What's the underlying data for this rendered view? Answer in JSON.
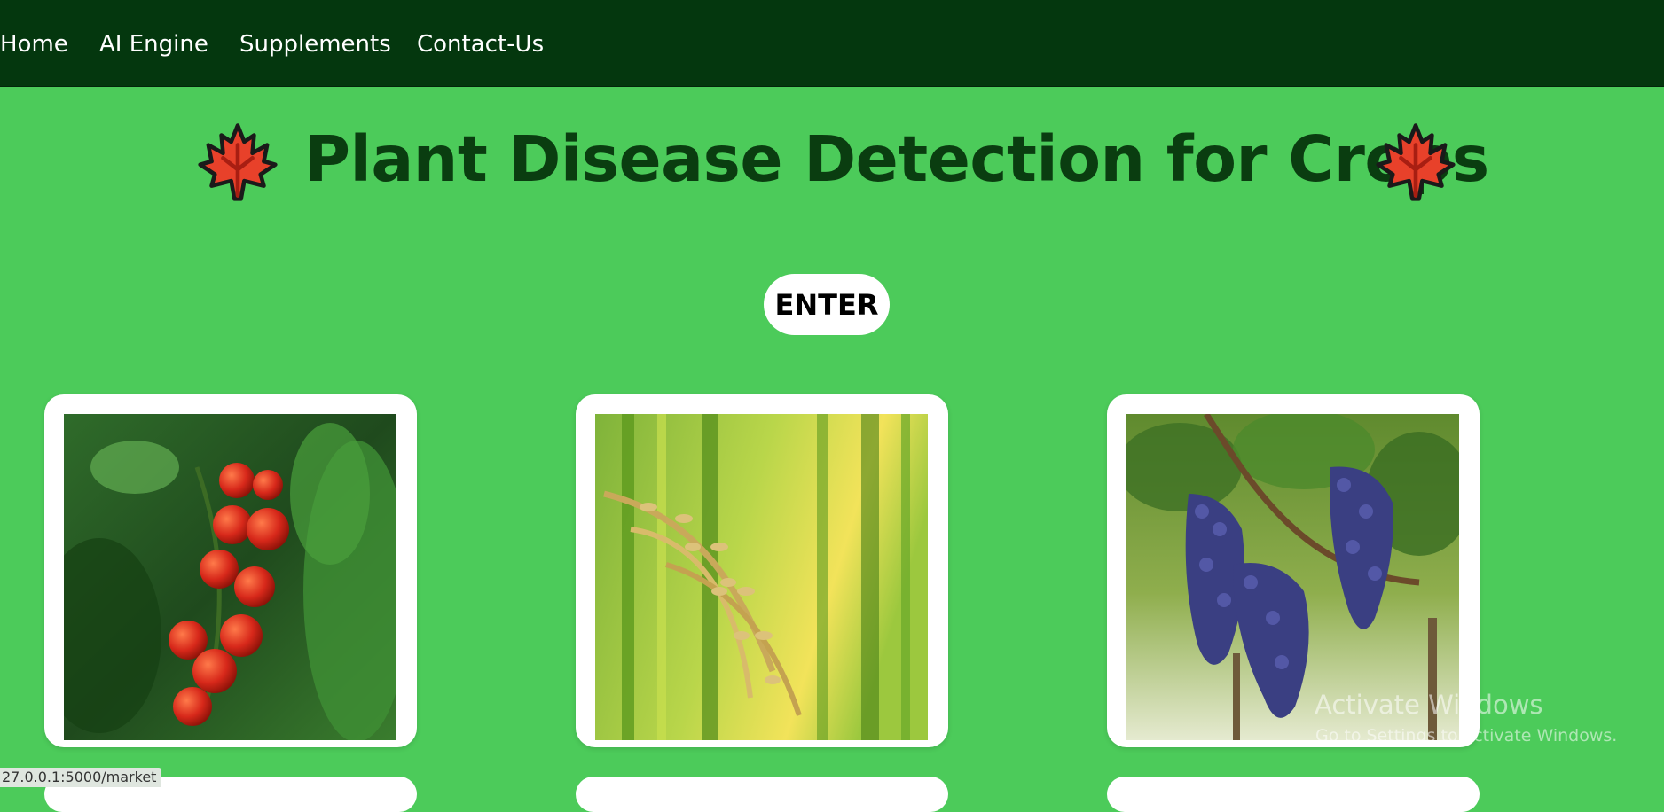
{
  "nav": {
    "items": [
      {
        "label": "Home"
      },
      {
        "label": "AI Engine"
      },
      {
        "label": "Supplements"
      },
      {
        "label": "Contact-Us"
      }
    ]
  },
  "header": {
    "title": "Plant Disease Detection for Crops",
    "leaf_icon": "maple-leaf-icon"
  },
  "enter_button": {
    "label": "ENTER"
  },
  "crops": [
    {
      "icon": "tomato-image"
    },
    {
      "icon": "rice-image"
    },
    {
      "icon": "grape-image"
    }
  ],
  "status_bar": {
    "url": "27.0.0.1:5000/market"
  },
  "watermark": {
    "title": "Activate Windows",
    "subtitle": "Go to Settings to activate Windows."
  },
  "colors": {
    "nav_bg": "#04370e",
    "page_bg": "#4ccb5a",
    "title": "#0a3d10"
  }
}
